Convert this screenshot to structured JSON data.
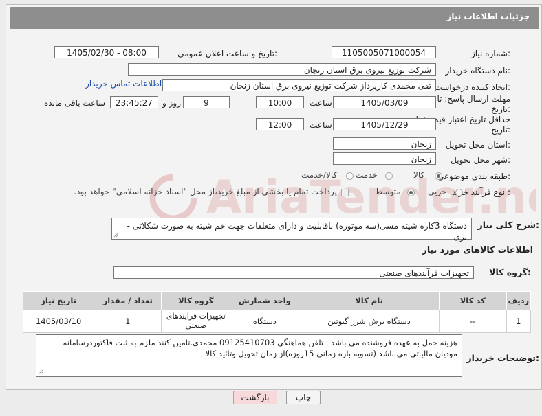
{
  "header": {
    "title": "جزئیات اطلاعات نیاز"
  },
  "fields": {
    "need_number_label": "شماره نیاز:",
    "need_number": "1105005071000054",
    "announce_label": "تاریخ و ساعت اعلان عمومی:",
    "announce_value": "1405/02/30 - 08:00",
    "buyer_org_label": "نام دستگاه خریدار:",
    "buyer_org": "شرکت توزیع نیروی برق استان زنجان",
    "requester_label": "ایجاد کننده درخواست:",
    "requester": "تقی محمدی کارپرداز شرکت توزیع نیروی برق استان زنجان",
    "contact_link": "اطلاعات تماس خریدار",
    "deadline_label": "مهلت ارسال پاسخ: تا تاریخ:",
    "deadline_date": "1405/03/09",
    "hour_label": "ساعت",
    "deadline_time": "10:00",
    "days_value": "9",
    "days_label": "روز و",
    "remaining_time": "23:45:27",
    "remaining_label": "ساعت باقی مانده",
    "validity_label": "حداقل تاریخ اعتبار قیمت: تا تاریخ:",
    "validity_date": "1405/12/29",
    "validity_time": "12:00",
    "province_label": "استان محل تحویل:",
    "province": "زنجان",
    "city_label": "شهر محل تحویل:",
    "city": "زنجان",
    "category_label": "طبقه بندی موضوعی:",
    "category_options": [
      "کالا",
      "خدمت",
      "کالا/خدمت"
    ],
    "process_label": "نوع فرآیند خرید :",
    "process_options": [
      "جزیی",
      "متوسط"
    ],
    "payment_note": "پرداخت تمام یا بخشی از مبلغ خرید،از محل \"اسناد خزانه اسلامی\" خواهد بود."
  },
  "description": {
    "label": "شرح کلی نیاز:",
    "text": "دستگاه 3کاره شیته مسی(سه موتوره) باقابلیت و دارای متعلقات جهت خم شیته به صورت شکلاتی - نری"
  },
  "goods": {
    "section_title": "اطلاعات کالاهای مورد نیاز",
    "group_label": "گروه کالا:",
    "group_value": "تجهیزات فرآیندهای صنعتی",
    "columns": [
      "ردیف",
      "کد کالا",
      "نام کالا",
      "واحد شمارش",
      "گروه کالا",
      "تعداد / مقدار",
      "تاریخ نیاز"
    ],
    "rows": [
      {
        "row": "1",
        "code": "--",
        "name": "دستگاه برش شرز گیوتین",
        "unit": "دستگاه",
        "group": "تجهیزات فرآیندهای صنعتی",
        "qty": "1",
        "date": "1405/03/10"
      }
    ]
  },
  "buyer_notes": {
    "label": "توضیحات خریدار:",
    "line1": "هزینه حمل به عهده فروشنده می باشد . تلفن هماهنگی 09125410703 محمدی.تامین کنند ملزم به ثبت فاکتوردرسامانه",
    "line2": "مودیان مالیاتی می باشد  (تسویه بازه زمانی 15روزه)از زمان تحویل وتائید کالا"
  },
  "buttons": {
    "print": "چاپ",
    "back": "بازگشت"
  },
  "watermark": "AriaTender.net",
  "colors": {
    "header_bg": "#8e8e8e",
    "link": "#1a4fa8",
    "back_button_bg": "#f7d9dc",
    "watermark": "#e7c9c9"
  }
}
